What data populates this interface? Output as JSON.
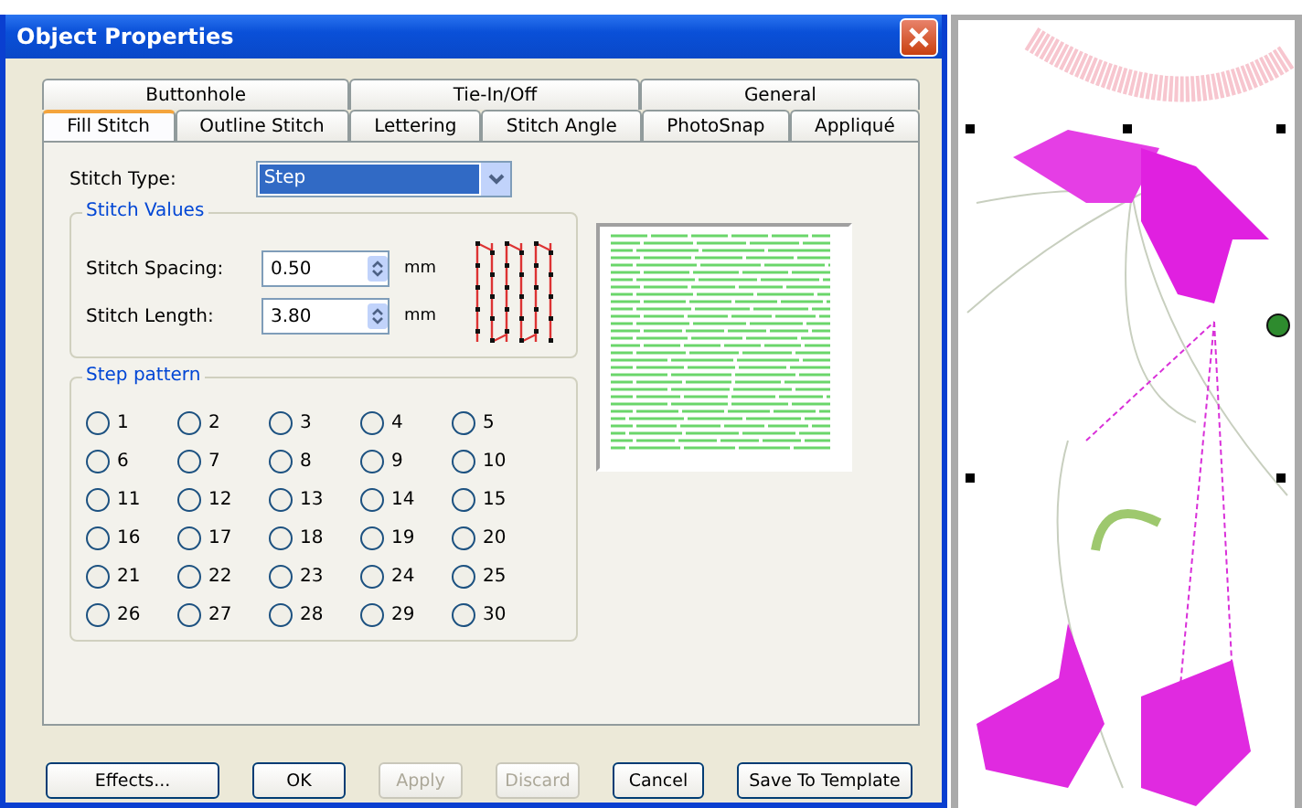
{
  "window": {
    "title": "Object Properties"
  },
  "tab_rows": [
    [
      {
        "label": "Buttonhole",
        "selected": false
      },
      {
        "label": "Tie-In/Off",
        "selected": false
      },
      {
        "label": "General",
        "selected": false
      }
    ],
    [
      {
        "label": "Fill Stitch",
        "selected": true
      },
      {
        "label": "Outline Stitch",
        "selected": false
      },
      {
        "label": "Lettering",
        "selected": false
      },
      {
        "label": "Stitch Angle",
        "selected": false
      },
      {
        "label": "PhotoSnap",
        "selected": false
      },
      {
        "label": "Appliqué",
        "selected": false
      }
    ]
  ],
  "stitch_type": {
    "label": "Stitch Type:",
    "value": "Step"
  },
  "stitch_values": {
    "title": "Stitch Values",
    "fields": [
      {
        "label": "Stitch Spacing:",
        "value": "0.50",
        "unit": "mm"
      },
      {
        "label": "Stitch Length:",
        "value": "3.80",
        "unit": "mm"
      }
    ]
  },
  "step_pattern": {
    "title": "Step pattern",
    "options": [
      {
        "label": "1",
        "selected": false
      },
      {
        "label": "2",
        "selected": false
      },
      {
        "label": "3",
        "selected": false
      },
      {
        "label": "4",
        "selected": false
      },
      {
        "label": "5",
        "selected": false
      },
      {
        "label": "6",
        "selected": false
      },
      {
        "label": "7",
        "selected": false
      },
      {
        "label": "8",
        "selected": false
      },
      {
        "label": "9",
        "selected": false
      },
      {
        "label": "10",
        "selected": false
      },
      {
        "label": "11",
        "selected": false
      },
      {
        "label": "12",
        "selected": false
      },
      {
        "label": "13",
        "selected": false
      },
      {
        "label": "14",
        "selected": false
      },
      {
        "label": "15",
        "selected": false
      },
      {
        "label": "16",
        "selected": false
      },
      {
        "label": "17",
        "selected": false
      },
      {
        "label": "18",
        "selected": false
      },
      {
        "label": "19",
        "selected": false
      },
      {
        "label": "20",
        "selected": false
      },
      {
        "label": "21",
        "selected": false
      },
      {
        "label": "22",
        "selected": false
      },
      {
        "label": "23",
        "selected": false
      },
      {
        "label": "24",
        "selected": false
      },
      {
        "label": "25",
        "selected": false
      },
      {
        "label": "26",
        "selected": false
      },
      {
        "label": "27",
        "selected": false
      },
      {
        "label": "28",
        "selected": false
      },
      {
        "label": "29",
        "selected": false
      },
      {
        "label": "30",
        "selected": false
      }
    ]
  },
  "buttons": [
    {
      "label": "Effects...",
      "disabled": false
    },
    {
      "label": "OK",
      "disabled": false
    },
    {
      "label": "Apply",
      "disabled": true
    },
    {
      "label": "Discard",
      "disabled": true
    },
    {
      "label": "Cancel",
      "disabled": false
    },
    {
      "label": "Save To Template",
      "disabled": false
    }
  ]
}
